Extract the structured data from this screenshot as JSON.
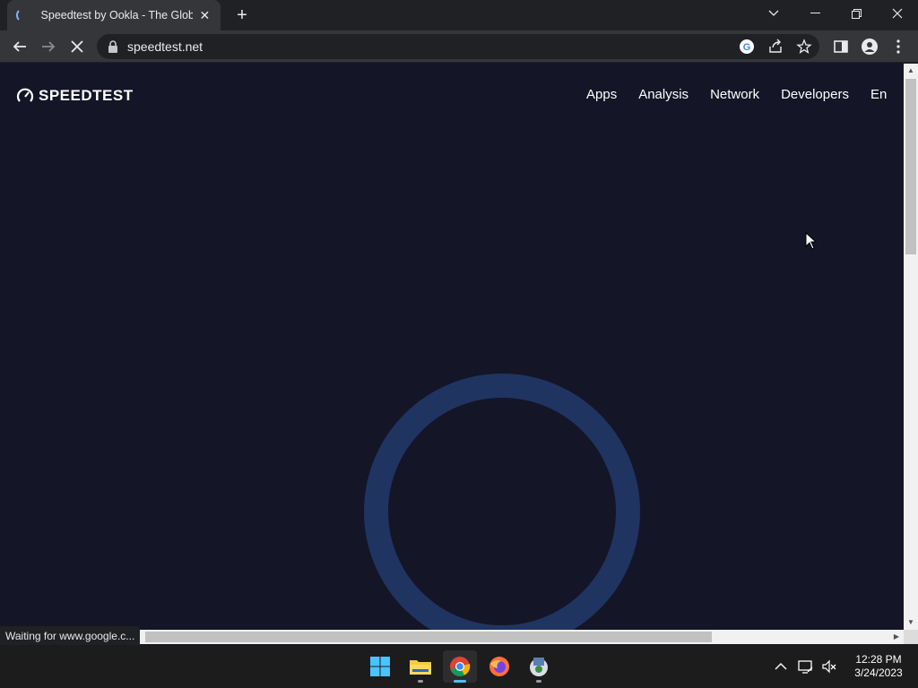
{
  "browser": {
    "tab_title": "Speedtest by Ookla - The Global",
    "url": "speedtest.net",
    "status_text": "Waiting for www.google.c..."
  },
  "site": {
    "logo_text": "SPEEDTEST",
    "nav": [
      "Apps",
      "Analysis",
      "Network",
      "Developers",
      "En"
    ]
  },
  "taskbar": {
    "time": "12:28 PM",
    "date": "3/24/2023",
    "apps": [
      "windows-start",
      "file-explorer",
      "chrome",
      "firefox",
      "installer"
    ]
  },
  "colors": {
    "page_bg": "#141526",
    "ring": "#1f3461",
    "accent": "#4cc2ff"
  }
}
